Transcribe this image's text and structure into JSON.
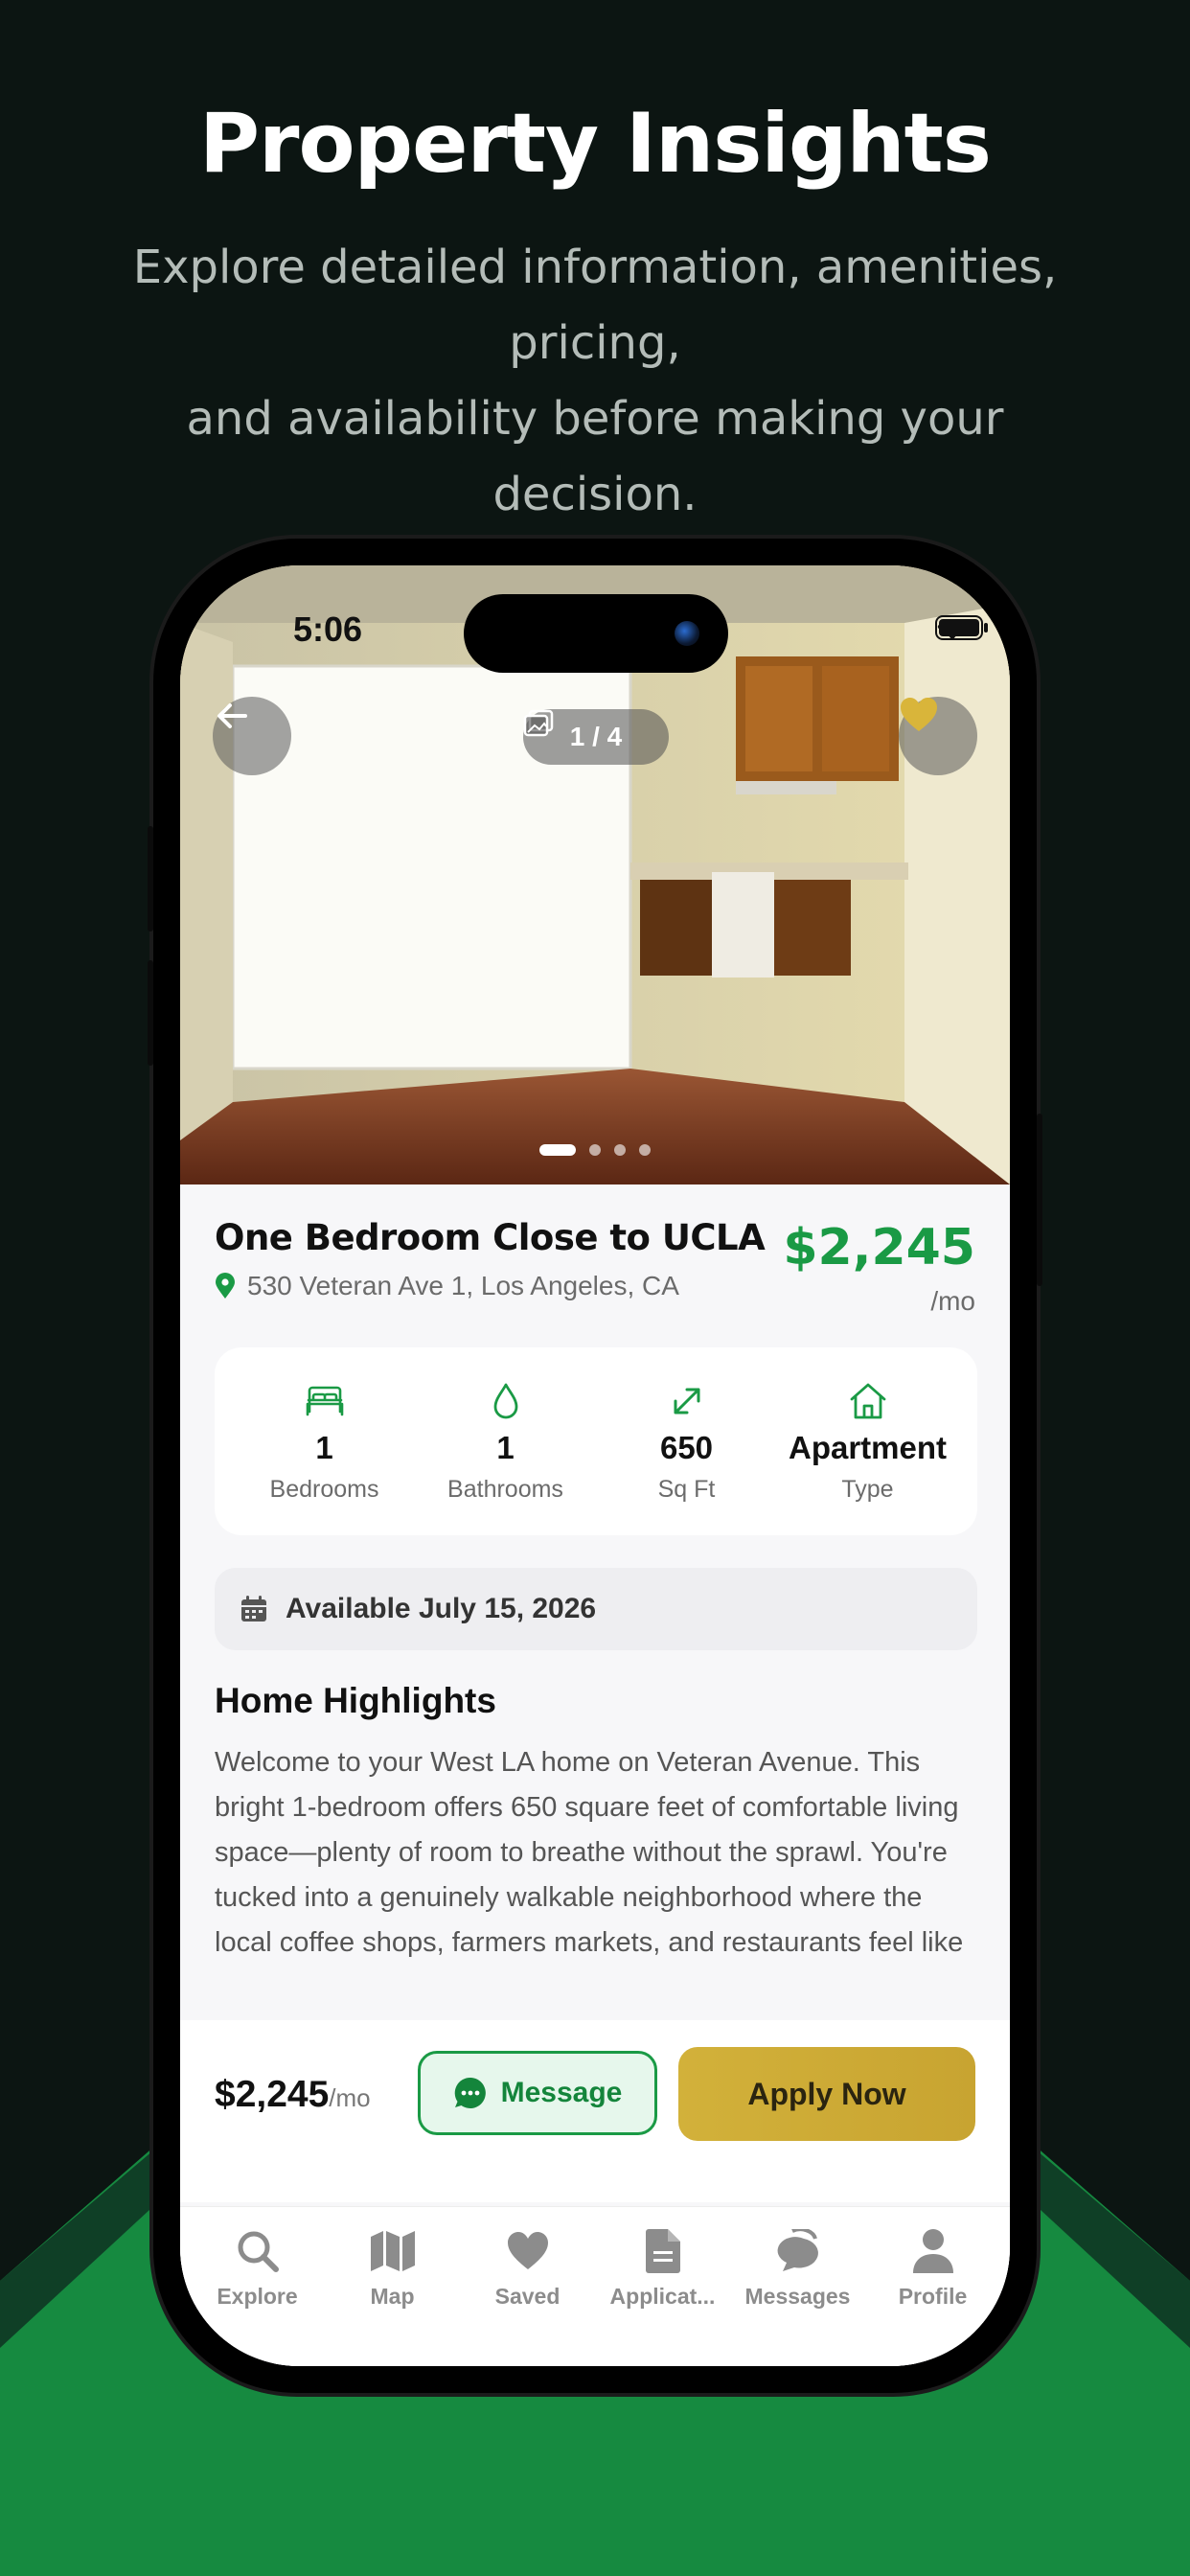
{
  "promo": {
    "title": "Property Insights",
    "subtitle_lines": [
      "Explore detailed information, amenities, pricing,",
      "and availability before making your",
      "decision."
    ]
  },
  "status_bar": {
    "time": "5:06"
  },
  "photo": {
    "counter": "1 / 4",
    "current_index": 1,
    "total": 4
  },
  "listing": {
    "title": "One Bedroom Close to UCLA",
    "address": "530 Veteran Ave 1, Los Angeles, CA",
    "price": "$2,245",
    "price_unit": "/mo"
  },
  "stats": [
    {
      "icon": "bed-icon",
      "value": "1",
      "label": "Bedrooms"
    },
    {
      "icon": "water-drop-icon",
      "value": "1",
      "label": "Bathrooms"
    },
    {
      "icon": "expand-arrows-icon",
      "value": "650",
      "label": "Sq Ft"
    },
    {
      "icon": "house-icon",
      "value": "Apartment",
      "label": "Type"
    }
  ],
  "availability": "Available July 15, 2026",
  "highlights": {
    "title": "Home Highlights",
    "body": "Welcome to your West LA home on Veteran Avenue. This bright 1-bedroom offers 650 square feet of comfortable living space—plenty of room to breathe without the sprawl. You're tucked into a genuinely walkable neighborhood where the local coffee shops, farmers markets, and restaurants feel like they're made for"
  },
  "action_bar": {
    "price": "$2,245",
    "price_unit": "/mo",
    "message_label": "Message",
    "apply_label": "Apply Now"
  },
  "tabs": [
    {
      "label": "Explore",
      "icon": "search-icon"
    },
    {
      "label": "Map",
      "icon": "map-icon"
    },
    {
      "label": "Saved",
      "icon": "heart-icon"
    },
    {
      "label": "Applicat...",
      "icon": "document-icon"
    },
    {
      "label": "Messages",
      "icon": "chat-bubbles-icon"
    },
    {
      "label": "Profile",
      "icon": "person-icon"
    }
  ],
  "colors": {
    "accent_green": "#1a9a45",
    "apply_gold": "#cfae38",
    "background_dark": "#0c1512",
    "background_green": "#168a40"
  }
}
